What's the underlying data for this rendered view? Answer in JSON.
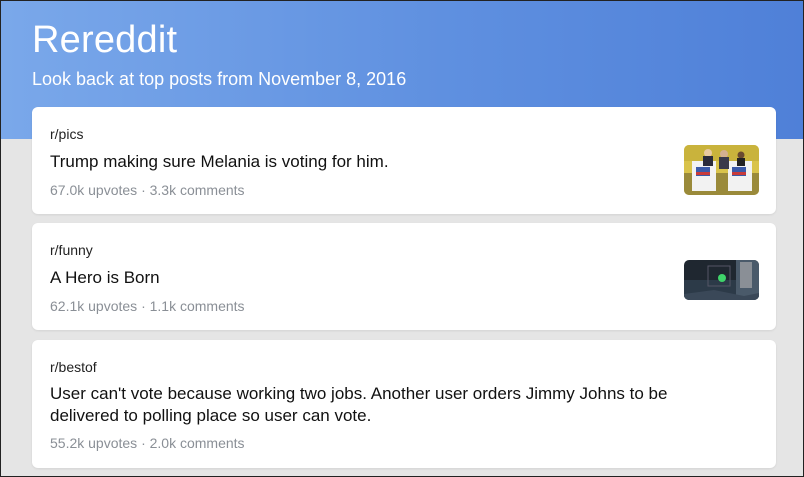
{
  "header": {
    "title": "Rereddit",
    "subtitle": "Look back at top posts from November 8, 2016"
  },
  "posts": [
    {
      "subreddit": "r/pics",
      "title": "Trump making sure Melania is voting for him.",
      "upvotes": "67.0k upvotes",
      "separator": "·",
      "comments": "3.3k comments",
      "thumbnail": "voting-booth-photo"
    },
    {
      "subreddit": "r/funny",
      "title": "A Hero is Born",
      "upvotes": "62.1k upvotes",
      "separator": "·",
      "comments": "1.1k comments",
      "thumbnail": "dark-street-photo"
    },
    {
      "subreddit": "r/bestof",
      "title_line1": "User can't vote because working two jobs. Another user orders Jimmy Johns to be",
      "title_line2": "delivered to polling place so user can vote.",
      "upvotes": "55.2k upvotes",
      "separator": "·",
      "comments": "2.0k comments"
    }
  ],
  "colors": {
    "header_gradient_start": "#7aa8ea",
    "header_gradient_end": "#4f80d8",
    "page_background": "#e5e5e5",
    "card_background": "#ffffff",
    "meta_text": "#8a8f96"
  }
}
